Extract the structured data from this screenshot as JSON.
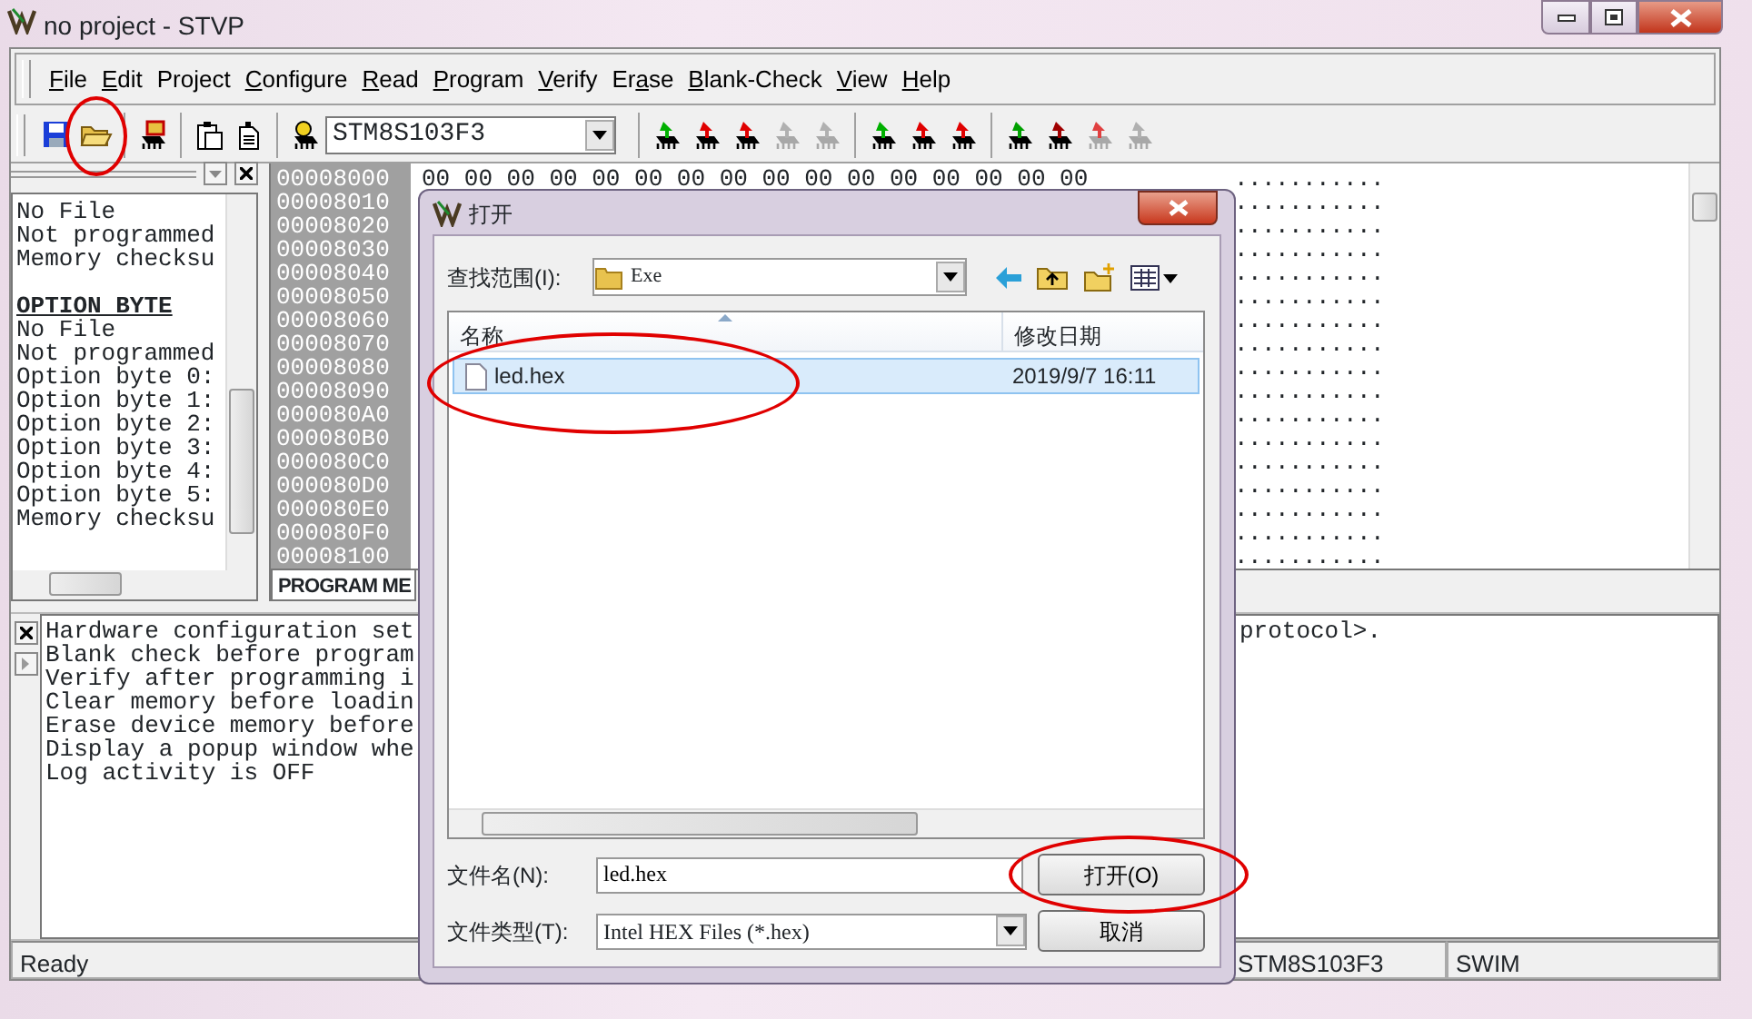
{
  "window": {
    "title": "no project - STVP"
  },
  "menu": [
    {
      "key": "F",
      "post": "ile"
    },
    {
      "key": "E",
      "post": "dit"
    },
    {
      "pre": "Pro",
      "key": "j",
      "post": "ect"
    },
    {
      "key": "C",
      "post": "onfigure"
    },
    {
      "key": "R",
      "post": "ead"
    },
    {
      "key": "P",
      "post": "rogram"
    },
    {
      "key": "V",
      "post": "erify"
    },
    {
      "pre": "Er",
      "key": "a",
      "post": "se"
    },
    {
      "key": "B",
      "post": "lank-Check"
    },
    {
      "key": "V",
      "post": "iew"
    },
    {
      "key": "H",
      "post": "elp"
    }
  ],
  "toolbar": [
    [
      {
        "kind": "save",
        "circled": false
      },
      {
        "kind": "open",
        "circled": true
      }
    ],
    [
      {
        "kind": "load",
        "circled": false
      }
    ],
    [
      {
        "kind": "paste",
        "circled": false
      },
      {
        "kind": "document",
        "circled": false
      }
    ],
    [
      {
        "kind": "device",
        "circled": false
      },
      {
        "kind": "device-select",
        "value": "STM8S103F3",
        "circled": false
      }
    ],
    [
      {
        "kind": "chip",
        "color": "#00b000",
        "disabled": false,
        "circled": false
      },
      {
        "kind": "chip",
        "color": "#e00000",
        "disabled": false,
        "circled": false
      },
      {
        "kind": "chip",
        "color": "#e00000",
        "disabled": false,
        "circled": false
      },
      {
        "kind": "chip",
        "color": "#b0b0b0",
        "disabled": true,
        "circled": false
      },
      {
        "kind": "chip",
        "color": "#b0b0b0",
        "disabled": true,
        "circled": false
      }
    ],
    [
      {
        "kind": "chip",
        "color": "#00b000",
        "disabled": false,
        "circled": false
      },
      {
        "kind": "chip",
        "color": "#e00000",
        "disabled": false,
        "circled": false
      },
      {
        "kind": "chip",
        "color": "#e00000",
        "disabled": false,
        "circled": false
      }
    ],
    [
      {
        "kind": "chip",
        "color": "#00a000",
        "disabled": false,
        "circled": false
      },
      {
        "kind": "chip",
        "color": "#a00000",
        "disabled": false,
        "circled": false
      },
      {
        "kind": "chip",
        "color": "#e04040",
        "disabled": true,
        "circled": false
      },
      {
        "kind": "chip",
        "color": "#b0b0b0",
        "disabled": true,
        "circled": false
      }
    ]
  ],
  "info_panel": {
    "lines": [
      {
        "text": "No File",
        "kind": "text"
      },
      {
        "text": "Not programmed",
        "kind": "text"
      },
      {
        "text": "Memory checksu",
        "kind": "text"
      },
      {
        "text": "OPTION BYTE",
        "kind": "heading"
      },
      {
        "text": "No File",
        "kind": "text"
      },
      {
        "text": "Not programmed",
        "kind": "text"
      },
      {
        "text": "Option byte 0:",
        "kind": "text"
      },
      {
        "text": "Option byte 1:",
        "kind": "text"
      },
      {
        "text": "Option byte 2:",
        "kind": "text"
      },
      {
        "text": "Option byte 3:",
        "kind": "text"
      },
      {
        "text": "Option byte 4:",
        "kind": "text"
      },
      {
        "text": "Option byte 5:",
        "kind": "text"
      },
      {
        "text": "Memory checksu",
        "kind": "text"
      }
    ]
  },
  "memory": {
    "rows": [
      {
        "address": "00008000",
        "bytes": "00 00 00 00 00 00 00 00 00 00 00 00 00 00 00 00",
        "ascii": "..........."
      },
      {
        "address": "00008010",
        "ascii": "..........."
      },
      {
        "address": "00008020",
        "ascii": "..........."
      },
      {
        "address": "00008030",
        "ascii": "..........."
      },
      {
        "address": "00008040",
        "ascii": "..........."
      },
      {
        "address": "00008050",
        "ascii": "..........."
      },
      {
        "address": "00008060",
        "ascii": "..........."
      },
      {
        "address": "00008070",
        "ascii": "..........."
      },
      {
        "address": "00008080",
        "ascii": "..........."
      },
      {
        "address": "00008090",
        "ascii": "..........."
      },
      {
        "address": "000080A0",
        "ascii": "..........."
      },
      {
        "address": "000080B0",
        "ascii": "..........."
      },
      {
        "address": "000080C0",
        "ascii": "..........."
      },
      {
        "address": "000080D0",
        "ascii": "..........."
      },
      {
        "address": "000080E0",
        "ascii": "..........."
      },
      {
        "address": "000080F0",
        "ascii": "..........."
      },
      {
        "address": "00008100",
        "ascii": "..........."
      }
    ],
    "tab": "PROGRAM ME"
  },
  "log": {
    "lines": [
      {
        "text": "Hardware configuration set",
        "tail": "protocol>."
      },
      {
        "text": "Blank check before program"
      },
      {
        "text": "Verify after programming i"
      },
      {
        "text": "Clear memory before loadin"
      },
      {
        "text": "Erase device memory before"
      },
      {
        "text": "Display a popup window whe"
      },
      {
        "text": "Log activity is OFF"
      }
    ]
  },
  "status_bar": [
    "Ready",
    "STM8S103F3",
    "SWIM"
  ],
  "dialog": {
    "title": "打开",
    "look_in_label": "查找范围(I):",
    "look_in": "Exe",
    "columns": [
      "名称",
      "修改日期"
    ],
    "files": [
      {
        "name": "led.hex",
        "modified": "2019/9/7 16:11",
        "selected": true,
        "circled": true
      }
    ],
    "filename_label": "文件名(N):",
    "filename": "led.hex",
    "filetype_label": "文件类型(T):",
    "filetype": "Intel HEX Files (*.hex)",
    "buttons": [
      {
        "label": "打开(O)",
        "circled": true
      },
      {
        "label": "取消",
        "circled": false
      }
    ]
  }
}
